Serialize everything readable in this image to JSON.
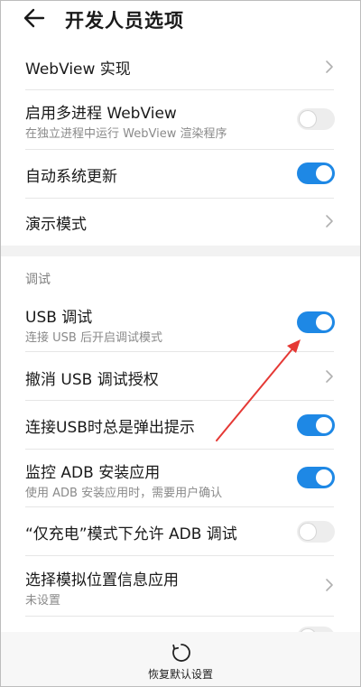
{
  "header": {
    "title": "开发人员选项",
    "back_icon": "arrow-left-icon"
  },
  "rows": [
    {
      "title": "WebView 实现",
      "subtitle": "",
      "control": "chevron"
    },
    {
      "title": "启用多进程 WebView",
      "subtitle": "在独立进程中运行 WebView 渲染程序",
      "control": "toggle",
      "state": "off"
    },
    {
      "title": "自动系统更新",
      "subtitle": "",
      "control": "toggle",
      "state": "on"
    },
    {
      "title": "演示模式",
      "subtitle": "",
      "control": "chevron"
    }
  ],
  "section": {
    "label": "调试"
  },
  "debug_rows": [
    {
      "title": "USB 调试",
      "subtitle": "连接 USB 后开启调试模式",
      "control": "toggle",
      "state": "on"
    },
    {
      "title": "撤消 USB 调试授权",
      "subtitle": "",
      "control": "chevron"
    },
    {
      "title": "连接USB时总是弹出提示",
      "subtitle": "",
      "control": "toggle",
      "state": "on"
    },
    {
      "title": "监控 ADB 安装应用",
      "subtitle": "使用 ADB 安装应用时，需要用户确认",
      "control": "toggle",
      "state": "on"
    },
    {
      "title": "“仅充电”模式下允许 ADB 调试",
      "subtitle": "",
      "control": "toggle",
      "state": "off"
    },
    {
      "title": "选择模拟位置信息应用",
      "subtitle": "未设置",
      "control": "chevron"
    }
  ],
  "bottom": {
    "reset_label": "恢复默认设置",
    "reset_icon": "restore-icon"
  },
  "colors": {
    "accent": "#1e88e5",
    "annotation": "#e53935"
  }
}
